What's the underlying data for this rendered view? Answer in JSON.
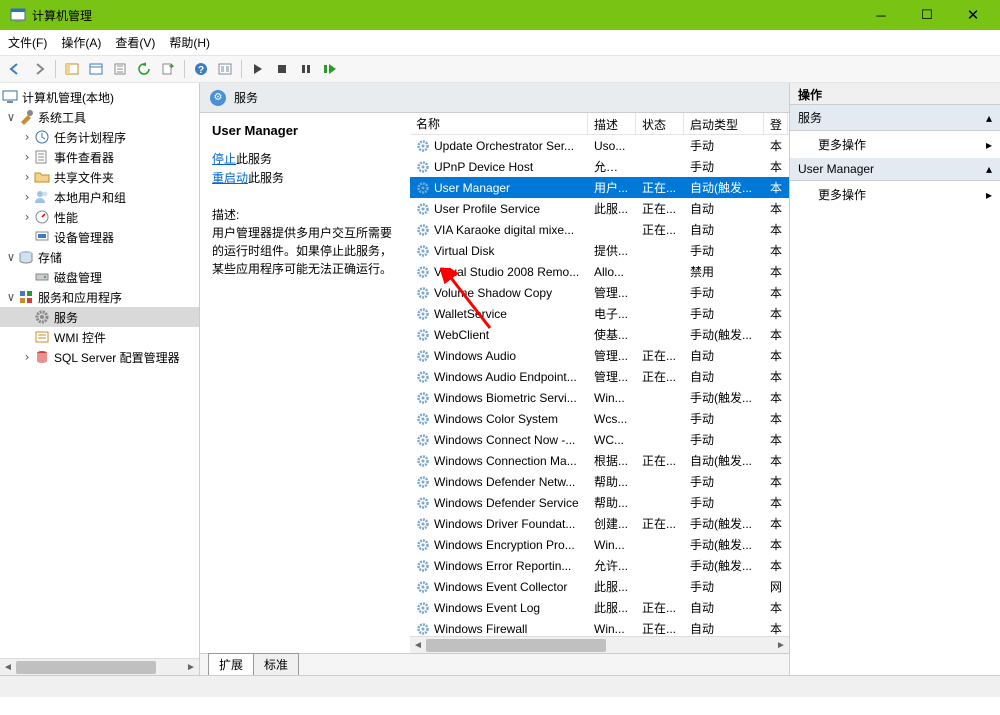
{
  "window": {
    "title": "计算机管理"
  },
  "menu": {
    "file": "文件(F)",
    "action": "操作(A)",
    "view": "查看(V)",
    "help": "帮助(H)"
  },
  "nav": {
    "root": "计算机管理(本地)",
    "systools": "系统工具",
    "taskscheduler": "任务计划程序",
    "eventviewer": "事件查看器",
    "sharedfolders": "共享文件夹",
    "localusers": "本地用户和组",
    "performance": "性能",
    "devicemgr": "设备管理器",
    "storage": "存储",
    "diskmgmt": "磁盘管理",
    "servicesapps": "服务和应用程序",
    "services": "服务",
    "wmi": "WMI 控件",
    "sqlcfg": "SQL Server 配置管理器"
  },
  "midheader": {
    "title": "服务"
  },
  "svcpanel": {
    "title": "User Manager",
    "stop": "停止",
    "stop_suffix": "此服务",
    "restart": "重启动",
    "restart_suffix": "此服务",
    "desc_label": "描述:",
    "desc_text": "用户管理器提供多用户交互所需要的运行时组件。如果停止此服务，某些应用程序可能无法正确运行。"
  },
  "cols": {
    "name": "名称",
    "desc": "描述",
    "status": "状态",
    "startup": "启动类型",
    "logon": "登"
  },
  "services": [
    {
      "name": "Update Orchestrator Ser...",
      "desc": "Uso...",
      "status": "",
      "startup": "手动",
      "logon": "本"
    },
    {
      "name": "UPnP Device Host",
      "desc": "允许 ...",
      "status": "",
      "startup": "手动",
      "logon": "本"
    },
    {
      "name": "User Manager",
      "desc": "用户...",
      "status": "正在...",
      "startup": "自动(触发...",
      "logon": "本",
      "selected": true
    },
    {
      "name": "User Profile Service",
      "desc": "此服...",
      "status": "正在...",
      "startup": "自动",
      "logon": "本"
    },
    {
      "name": "VIA Karaoke digital mixe...",
      "desc": "",
      "status": "正在...",
      "startup": "自动",
      "logon": "本"
    },
    {
      "name": "Virtual Disk",
      "desc": "提供...",
      "status": "",
      "startup": "手动",
      "logon": "本"
    },
    {
      "name": "Visual Studio 2008 Remo...",
      "desc": "Allo...",
      "status": "",
      "startup": "禁用",
      "logon": "本"
    },
    {
      "name": "Volume Shadow Copy",
      "desc": "管理...",
      "status": "",
      "startup": "手动",
      "logon": "本"
    },
    {
      "name": "WalletService",
      "desc": "电子...",
      "status": "",
      "startup": "手动",
      "logon": "本"
    },
    {
      "name": "WebClient",
      "desc": "使基...",
      "status": "",
      "startup": "手动(触发...",
      "logon": "本"
    },
    {
      "name": "Windows Audio",
      "desc": "管理...",
      "status": "正在...",
      "startup": "自动",
      "logon": "本"
    },
    {
      "name": "Windows Audio Endpoint...",
      "desc": "管理...",
      "status": "正在...",
      "startup": "自动",
      "logon": "本"
    },
    {
      "name": "Windows Biometric Servi...",
      "desc": "Win...",
      "status": "",
      "startup": "手动(触发...",
      "logon": "本"
    },
    {
      "name": "Windows Color System",
      "desc": "Wcs...",
      "status": "",
      "startup": "手动",
      "logon": "本"
    },
    {
      "name": "Windows Connect Now -...",
      "desc": "WC...",
      "status": "",
      "startup": "手动",
      "logon": "本"
    },
    {
      "name": "Windows Connection Ma...",
      "desc": "根据...",
      "status": "正在...",
      "startup": "自动(触发...",
      "logon": "本"
    },
    {
      "name": "Windows Defender Netw...",
      "desc": "帮助...",
      "status": "",
      "startup": "手动",
      "logon": "本"
    },
    {
      "name": "Windows Defender Service",
      "desc": "帮助...",
      "status": "",
      "startup": "手动",
      "logon": "本"
    },
    {
      "name": "Windows Driver Foundat...",
      "desc": "创建...",
      "status": "正在...",
      "startup": "手动(触发...",
      "logon": "本"
    },
    {
      "name": "Windows Encryption Pro...",
      "desc": "Win...",
      "status": "",
      "startup": "手动(触发...",
      "logon": "本"
    },
    {
      "name": "Windows Error Reportin...",
      "desc": "允许...",
      "status": "",
      "startup": "手动(触发...",
      "logon": "本"
    },
    {
      "name": "Windows Event Collector",
      "desc": "此服...",
      "status": "",
      "startup": "手动",
      "logon": "网"
    },
    {
      "name": "Windows Event Log",
      "desc": "此服...",
      "status": "正在...",
      "startup": "自动",
      "logon": "本"
    },
    {
      "name": "Windows Firewall",
      "desc": "Win...",
      "status": "正在...",
      "startup": "自动",
      "logon": "本"
    }
  ],
  "tabs": {
    "extended": "扩展",
    "standard": "标准"
  },
  "actions": {
    "header": "操作",
    "sec1": "服务",
    "item1": "更多操作",
    "sec2": "User Manager",
    "item2": "更多操作"
  }
}
